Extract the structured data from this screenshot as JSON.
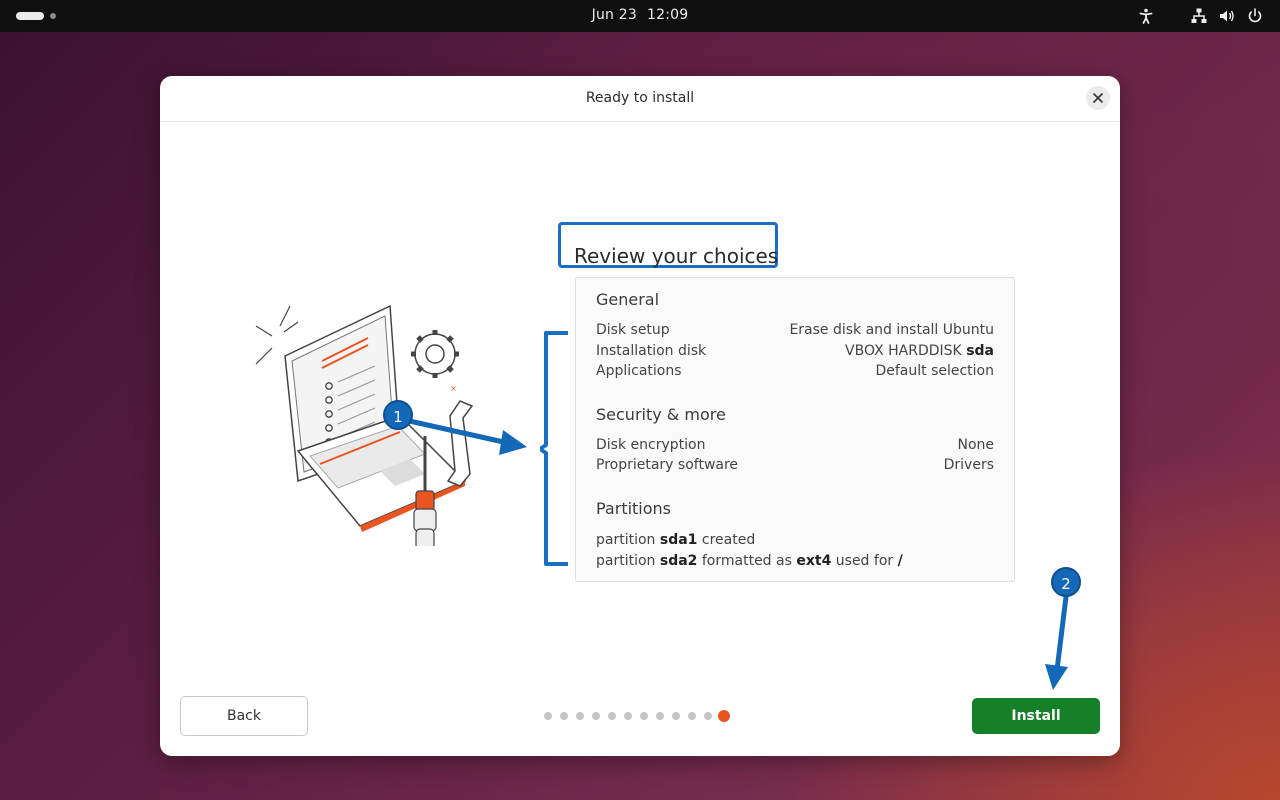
{
  "topbar": {
    "date": "Jun 23",
    "time": "12:09",
    "icons": [
      "activities-pill",
      "workspace-dot",
      "accessibility-icon",
      "network-icon",
      "volume-icon",
      "power-icon"
    ]
  },
  "window": {
    "title": "Ready to install",
    "close_icon": "close-icon"
  },
  "review": {
    "title": "Review your choices",
    "general": {
      "title": "General",
      "rows": [
        {
          "key": "Disk setup",
          "value": "Erase disk and install Ubuntu"
        },
        {
          "key": "Installation disk",
          "value_prefix": "VBOX HARDDISK ",
          "value_bold": "sda"
        },
        {
          "key": "Applications",
          "value": "Default selection"
        }
      ]
    },
    "security": {
      "title": "Security & more",
      "rows": [
        {
          "key": "Disk encryption",
          "value": "None"
        },
        {
          "key": "Proprietary software",
          "value": "Drivers"
        }
      ]
    },
    "partitions": {
      "title": "Partitions",
      "line1": {
        "p1": "partition ",
        "b1": "sda1",
        "p2": " created"
      },
      "line2": {
        "p1": "partition ",
        "b1": "sda2",
        "p2": " formatted as ",
        "b2": "ext4",
        "p3": " used for ",
        "b3": "/"
      }
    }
  },
  "annotations": {
    "badge1": "1",
    "badge2": "2",
    "highlight_color": "#1b6fc0"
  },
  "footer": {
    "back_label": "Back",
    "install_label": "Install",
    "steps_total": 12,
    "steps_current": 12
  },
  "colors": {
    "accent": "#e95420",
    "install": "#168029"
  }
}
